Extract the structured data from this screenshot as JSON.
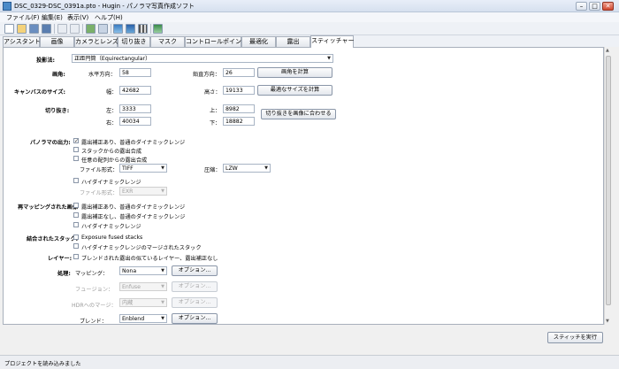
{
  "window": {
    "title": "DSC_0329-DSC_0391a.pto - Hugin - パノラマ写真作成ソフト"
  },
  "menubar": {
    "items": [
      "ファイル(F)",
      "編集(E)",
      "表示(V)",
      "ヘルプ(H)"
    ]
  },
  "tabs": [
    "アシスタント",
    "画像",
    "カメラとレンズ",
    "切り抜き",
    "マスク",
    "コントロールポイント",
    "最適化",
    "露出",
    "スティッチャー"
  ],
  "active_tab": "スティッチャー",
  "projection": {
    "label": "投影法:",
    "value": "正距円筒（Equirectangular）"
  },
  "fov": {
    "label": "画角:",
    "h_label": "水平方向：",
    "h_value": "58",
    "v_label": "鉛直方向：",
    "v_value": "26",
    "button": "画角を計算"
  },
  "canvas": {
    "label": "キャンバスのサイズ:",
    "w_label": "幅：",
    "w_value": "42682",
    "h_label": "高さ：",
    "h_value": "19133",
    "button": "最適なサイズを計算"
  },
  "crop": {
    "label": "切り抜き:",
    "left_label": "左：",
    "left_value": "3333",
    "right_label": "右：",
    "right_value": "40034",
    "top_label": "上：",
    "top_value": "8982",
    "bottom_label": "下：",
    "bottom_value": "18882",
    "button": "切り抜きを画像に合わせる"
  },
  "output": {
    "label": "パノラマの出力:",
    "opt1": "露出補正あり、普通のダイナミックレンジ",
    "opt2": "スタックからの露出合成",
    "opt3": "任意の配列からの露出合成",
    "file_format_label": "ファイル形式：",
    "file_format_value": "TIFF",
    "compression_label": "圧縮：",
    "compression_value": "LZW",
    "opt4": "ハイダイナミックレンジ",
    "hdr_format_label": "ファイル形式：",
    "hdr_format_value": "EXR"
  },
  "remapped": {
    "label": "再マッピングされた画像",
    "opt1": "露出補正あり、普通のダイナミックレンジ",
    "opt2": "露出補正なし、普通のダイナミックレンジ",
    "opt3": "ハイダイナミックレンジ"
  },
  "combined": {
    "label": "結合されたスタック:",
    "opt1": "Exposure fused stacks",
    "opt2": "ハイダイナミックレンジのマージされたスタック"
  },
  "layers": {
    "label": "レイヤー:",
    "opt1": "ブレンドされた露出の似ているレイヤー、露出補正なし"
  },
  "processing": {
    "label": "処理:",
    "mapping_label": "マッピング：",
    "mapping_value": "Nona",
    "fusion_label": "フュージョン：",
    "fusion_value": "Enfuse",
    "hdr_label": "HDRへのマージ：",
    "hdr_value": "内蔵",
    "blend_label": "ブレンド：",
    "blend_value": "Enblend",
    "options_button": "オプション..."
  },
  "stitch_button": "スティッチを実行",
  "status": "プロジェクトを読み込みました"
}
